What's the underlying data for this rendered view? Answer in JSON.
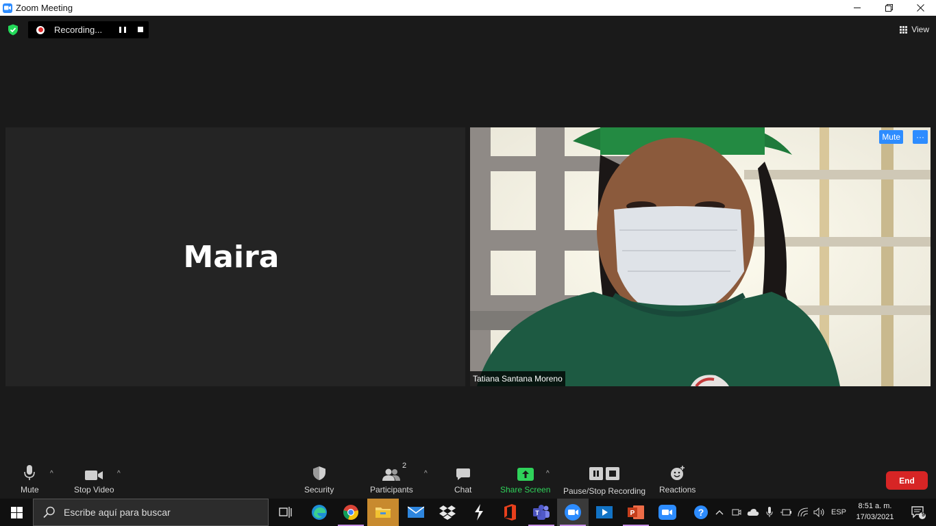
{
  "window": {
    "title": "Zoom Meeting"
  },
  "recording": {
    "status": "Recording..."
  },
  "view": {
    "label": "View"
  },
  "participants_grid": {
    "left_tile": {
      "name": "Maira"
    },
    "right_tile": {
      "name": "Tatiana Santana Moreno",
      "mute_label": "Mute",
      "more_label": "···"
    }
  },
  "toolbar": {
    "mute_label": "Mute",
    "stop_video_label": "Stop Video",
    "security_label": "Security",
    "participants_label": "Participants",
    "participants_count": "2",
    "chat_label": "Chat",
    "share_label": "Share Screen",
    "recording_label": "Pause/Stop Recording",
    "reactions_label": "Reactions",
    "end_label": "End"
  },
  "taskbar": {
    "search_placeholder": "Escribe aquí para buscar",
    "language": "ESP",
    "time": "8:51 a. m.",
    "date": "17/03/2021",
    "notification_count": "9"
  },
  "colors": {
    "accent": "#2d8cff",
    "end": "#d72525",
    "share": "#2fd25a"
  }
}
